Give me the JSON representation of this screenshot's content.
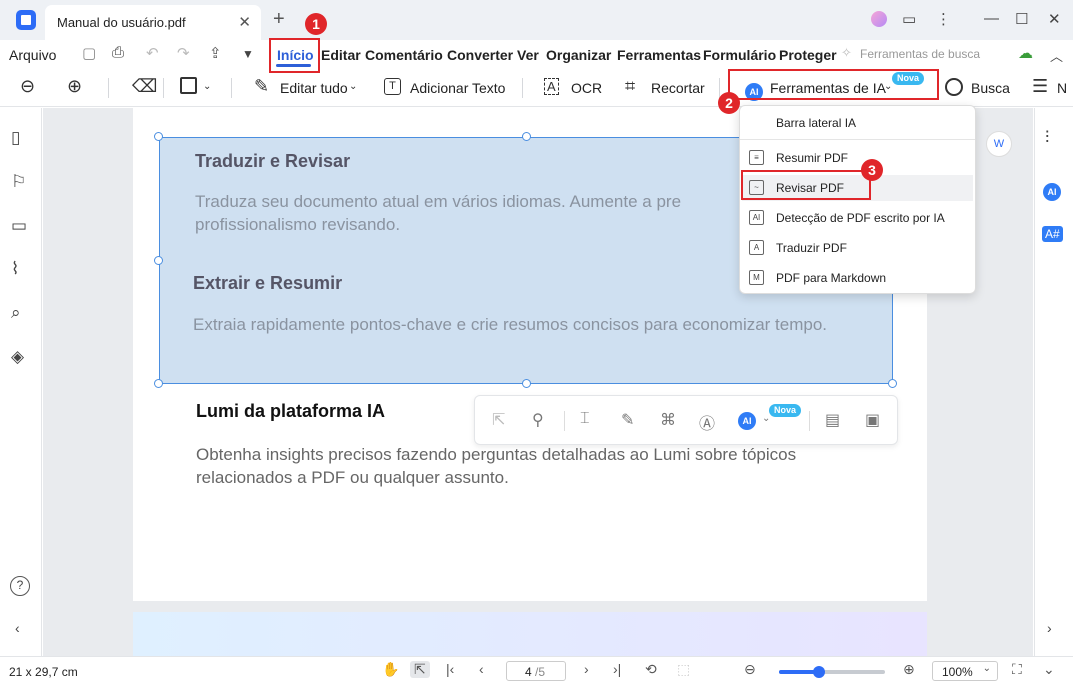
{
  "tab": {
    "title": "Manual do usuário.pdf"
  },
  "menu": {
    "arquivo": "Arquivo",
    "items": [
      "Início",
      "Editar",
      "Comentário",
      "Converter",
      "Ver",
      "Organizar",
      "Ferramentas",
      "Formulário",
      "Proteger"
    ],
    "search_tools": "Ferramentas de busca"
  },
  "toolbar": {
    "editar_tudo": "Editar tudo",
    "adicionar_texto": "Adicionar Texto",
    "ocr": "OCR",
    "recortar": "Recortar",
    "ferramentas_ia": "Ferramentas de IA",
    "nova": "Nova",
    "busca": "Busca",
    "more": "N"
  },
  "document": {
    "section1_title": "Traduzir e Revisar",
    "section1_line1": "Traduza seu documento atual em vários idiomas. Aumente a pre",
    "section1_line2": "profissionalismo revisando.",
    "section2_title": "Extrair e Resumir",
    "section2_body": "Extraia rapidamente pontos-chave e crie resumos concisos para economizar tempo.",
    "section3_title": "Lumi da plataforma IA",
    "section3_body": "Obtenha insights precisos fazendo perguntas detalhadas ao Lumi sobre tópicos relacionados a PDF ou qualquer assunto."
  },
  "float_toolbar": {
    "ai_label": "AI",
    "nova": "Nova"
  },
  "dropdown": {
    "items": [
      "Barra lateral IA",
      "Resumir PDF",
      "Revisar PDF",
      "Detecção de PDF escrito por IA",
      "Traduzir PDF",
      "PDF para Markdown"
    ],
    "hovered_index": 2
  },
  "annotations": {
    "badges": [
      "1",
      "2",
      "3"
    ]
  },
  "status": {
    "page_size": "21 x 29,7 cm",
    "current_page": "4",
    "total_pages": "/5",
    "zoom": "100%",
    "zoom_fraction": 0.38
  },
  "icons": {
    "ai": "AI",
    "ai_translate": "A#"
  }
}
